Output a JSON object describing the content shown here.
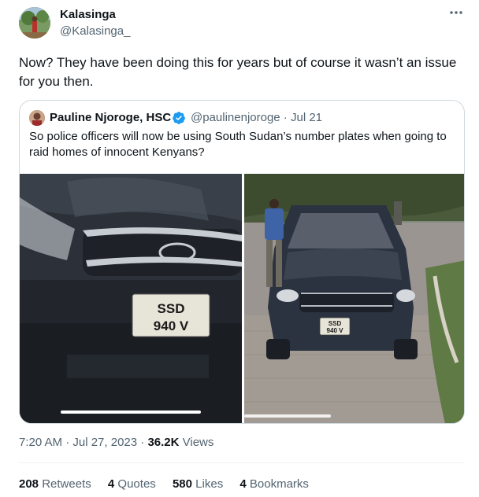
{
  "author": {
    "name": "Kalasinga",
    "handle": "@Kalasinga_"
  },
  "more_icon": "more-horizontal-icon",
  "tweet_text": "Now? They have been doing this for years but of course it wasn’t an issue for you then.",
  "quoted": {
    "name": "Pauline Njoroge, HSC",
    "verified_icon": "verified-badge-icon",
    "handle_date": "@paulinenjoroge · Jul 21",
    "text": "So police officers will now be using South Sudan’s number plates when going to raid homes of innocent Kenyans?",
    "plate_line1": "SSD",
    "plate_line2": "940 V"
  },
  "meta": {
    "timestamp": "7:20 AM · Jul 27, 2023 · ",
    "views_count": "36.2K",
    "views_label": " Views"
  },
  "stats": {
    "retweets_count": "208",
    "retweets_label": "Retweets",
    "quotes_count": "4",
    "quotes_label": "Quotes",
    "likes_count": "580",
    "likes_label": "Likes",
    "bookmarks_count": "4",
    "bookmarks_label": "Bookmarks"
  },
  "colors": {
    "text_primary": "#0f1419",
    "text_secondary": "#536471",
    "border": "#cfd9de",
    "verified_blue": "#1d9bf0"
  }
}
